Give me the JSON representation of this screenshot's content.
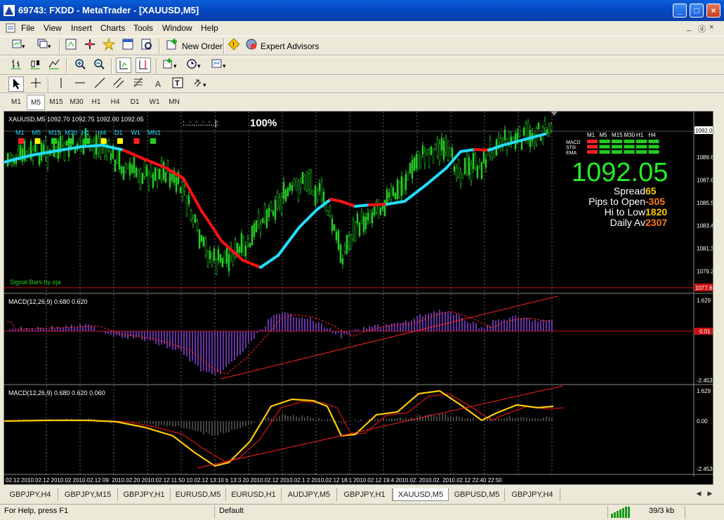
{
  "window": {
    "title": "69743: FXDD - MetaTrader - [XAUUSD,M5]",
    "buttons": [
      "_",
      "□",
      "×"
    ]
  },
  "menu": {
    "items": [
      "File",
      "View",
      "Insert",
      "Charts",
      "Tools",
      "Window",
      "Help"
    ],
    "mdi_buttons": [
      "_",
      "ⓓ",
      "×"
    ]
  },
  "toolbar": {
    "new_order": "New Order",
    "expert_advisors": "Expert Advisors"
  },
  "drawing_toolbar": {
    "text_tool": "A",
    "label_tool": "T"
  },
  "timeframes": {
    "items": [
      "M1",
      "M5",
      "M15",
      "M30",
      "H1",
      "H4",
      "D1",
      "W1",
      "MN"
    ],
    "active": "M5"
  },
  "chart": {
    "symbol_info": "XAUUSD,M5  1092.70 1092.75 1092.00 1092.05",
    "progress_text": ":..:..:..:..:..|:",
    "progress_percent": "100%",
    "tf_labels": [
      "M1",
      "M5",
      "M15",
      "M30",
      "H1",
      "H4",
      "D1",
      "W1",
      "MN1"
    ],
    "tf_colors": [
      "#ff2020",
      "#ffff00",
      "#22cc22",
      "#22cc22",
      "#22cc22",
      "#ffff00",
      "#ffff00",
      "#ff2020",
      "#22cc22"
    ],
    "signal_label": "Signal Bars by oja",
    "current_price_label": "1092.05",
    "bottom_price_label": "1077.62",
    "price_axis": [
      "1089.65",
      "1087.60",
      "1085.50",
      "1083.45",
      "1081.35",
      "1079.25"
    ],
    "panel_headers": [
      "M1",
      "M5",
      "M15",
      "M30",
      "H1",
      "H4"
    ],
    "panel_rows": [
      "MACD",
      "STR",
      "EMA"
    ],
    "panel_row_states": [
      [
        "#ff2020",
        "#22cc22",
        "#22cc22",
        "#22cc22",
        "#22cc22",
        "#22cc22"
      ],
      [
        "#ff2020",
        "#22cc22",
        "#22cc22",
        "#22cc22",
        "#22cc22",
        "#22cc22"
      ],
      [
        "#ff2020",
        "#22cc22",
        "#22cc22",
        "#22cc22",
        "#22cc22",
        "#22cc22"
      ]
    ],
    "big_price": "1092.05",
    "stats": [
      {
        "label": "Spread",
        "value": "65"
      },
      {
        "label": "Pips to Open",
        "value": "-305"
      },
      {
        "label": "Hi to Low",
        "value": "1820"
      },
      {
        "label": "Daily Av",
        "value": "2307"
      }
    ],
    "macd1_label": "MACD(12,26,9) 0.680 0.620",
    "macd1_axis": [
      "1.629",
      "0.01",
      "-2.453"
    ],
    "macd2_label": "MACD(12,26,9) 0.680 0.620 0.060",
    "macd2_axis": [
      "1.629",
      "0.00",
      "-2.453"
    ],
    "time_axis": "02.12 2010.02.12 2010.02 2010.02.12 09:  2010.02.20  2010.02.12 11:50 10.02.12 13:10 b 13:3 20 2010.02.12 2010.02.1 2 2010.02.12 18:1 2010.02.12 19:4 2010.02.  2010.02.  2010.02.12 22:40  22:50"
  },
  "tabs": {
    "items": [
      "GBPJPY,H4",
      "GBPJPY,M15",
      "GBPJPY,H1",
      "EURUSD,M5",
      "EURUSD,H1",
      "AUDJPY,M5",
      "GBPJPY,H1",
      "XAUUSD,M5",
      "GBPUSD,M5",
      "GBPJPY,H4"
    ],
    "active": "XAUUSD,M5"
  },
  "status": {
    "help": "For Help, press F1",
    "profile": "Default",
    "traffic": "39/3 kb"
  },
  "colors": {
    "candle": "#22cc22",
    "ema_up": "#22ddff",
    "ema_down": "#ff1111",
    "macd_hist": "#8844dd",
    "macd2_line": "#ffcc00",
    "grid_red": "#cc1111"
  }
}
